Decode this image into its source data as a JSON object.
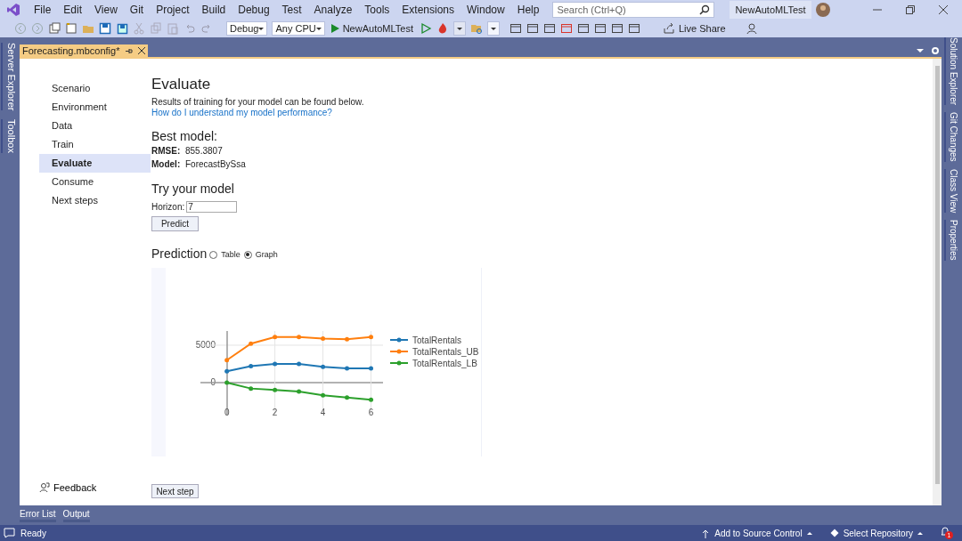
{
  "menu": [
    "File",
    "Edit",
    "View",
    "Git",
    "Project",
    "Build",
    "Debug",
    "Test",
    "Analyze",
    "Tools",
    "Extensions",
    "Window",
    "Help"
  ],
  "search": {
    "placeholder": "Search (Ctrl+Q)"
  },
  "solution_title": "NewAutoMLTest",
  "toolbar": {
    "configuration": "Debug",
    "platform": "Any CPU",
    "start": "NewAutoMLTest",
    "live_share": "Live Share"
  },
  "left_rail": [
    "Server Explorer",
    "Toolbox"
  ],
  "right_rail": [
    "Solution Explorer",
    "Git Changes",
    "Class View",
    "Properties"
  ],
  "document_tab": {
    "title": "Forecasting.mbconfig*"
  },
  "steps": [
    {
      "label": "Scenario",
      "selected": false
    },
    {
      "label": "Environment",
      "selected": false
    },
    {
      "label": "Data",
      "selected": false
    },
    {
      "label": "Train",
      "selected": false
    },
    {
      "label": "Evaluate",
      "selected": true
    },
    {
      "label": "Consume",
      "selected": false
    },
    {
      "label": "Next steps",
      "selected": false
    }
  ],
  "feedback": "Feedback",
  "evaluate": {
    "heading": "Evaluate",
    "description": "Results of training for your model can be found below.",
    "help_link": "How do I understand my model performance?",
    "best_model_heading": "Best model:",
    "metrics": [
      {
        "label": "RMSE:",
        "value": "855.3807"
      },
      {
        "label": "Model:",
        "value": "ForecastBySsa"
      }
    ],
    "try_heading": "Try your model",
    "horizon": {
      "label": "Horizon:",
      "value": "7"
    },
    "predict_button": "Predict",
    "prediction_heading": "Prediction",
    "views": [
      {
        "label": "Table",
        "selected": false
      },
      {
        "label": "Graph",
        "selected": true
      }
    ],
    "chart_data": {
      "type": "line",
      "x": [
        0,
        1,
        2,
        3,
        4,
        5,
        6
      ],
      "xticks": [
        0,
        2,
        4,
        6
      ],
      "yticks": [
        0,
        5000
      ],
      "xlim": [
        -1.1,
        6.5
      ],
      "ylim": [
        -4300,
        6900
      ],
      "legend": true,
      "grid": true,
      "series": [
        {
          "name": "TotalRentals",
          "color": "#1f77b4",
          "values": [
            1500,
            2200,
            2500,
            2500,
            2100,
            1900,
            1900
          ]
        },
        {
          "name": "TotalRentals_UB",
          "color": "#ff7f0e",
          "values": [
            3000,
            5200,
            6100,
            6100,
            5900,
            5800,
            6100
          ]
        },
        {
          "name": "TotalRentals_LB",
          "color": "#2ca02c",
          "values": [
            0,
            -800,
            -1000,
            -1200,
            -1700,
            -2000,
            -2300
          ]
        }
      ]
    },
    "next_button": "Next step"
  },
  "tool_tabs": [
    "Error List",
    "Output"
  ],
  "status": {
    "text": "Ready",
    "items": [
      "Add to Source Control",
      "Select Repository"
    ],
    "notification_count": "1"
  }
}
